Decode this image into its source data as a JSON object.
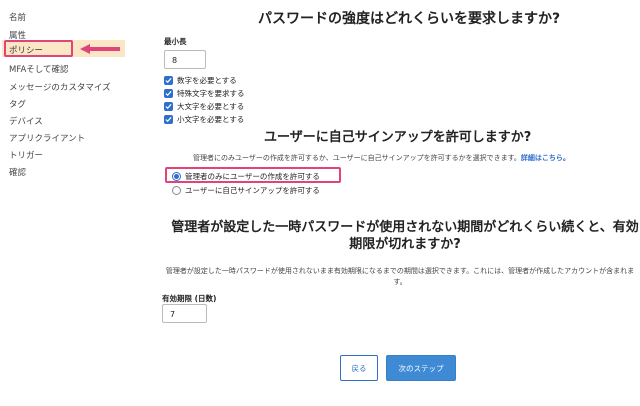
{
  "sidebar": {
    "items": [
      "名前",
      "属性",
      "ポリシー",
      "MFAそして確認",
      "メッセージのカスタマイズ",
      "タグ",
      "デバイス",
      "アプリクライアント",
      "トリガー",
      "確認"
    ],
    "active_index": 2
  },
  "password": {
    "title": "パスワードの強度はどれくらいを要求しますか?",
    "min_length_label": "最小長",
    "min_length_value": "8",
    "checkboxes": [
      {
        "label": "数字を必要とする",
        "checked": true
      },
      {
        "label": "特殊文字を要求する",
        "checked": true
      },
      {
        "label": "大文字を必要とする",
        "checked": true
      },
      {
        "label": "小文字を必要とする",
        "checked": true
      }
    ]
  },
  "signup": {
    "title": "ユーザーに自己サインアップを許可しますか?",
    "description": "管理者にのみユーザーの作成を許可するか、ユーザーに自己サインアップを許可するかを選択できます。",
    "link_text": "詳細はこちら。",
    "options": [
      {
        "label": "管理者のみにユーザーの作成を許可する",
        "selected": true
      },
      {
        "label": "ユーザーに自己サインアップを許可する",
        "selected": false
      }
    ]
  },
  "expiry": {
    "title": "管理者が設定した一時パスワードが使用されない期間がどれくらい続くと、有効期限が切れますか?",
    "description": "管理者が設定した一時パスワードが使用されないまま有効期限になるまでの期間は選択できます。これには、管理者が作成したアカウントが含まれます。",
    "days_label": "有効期限 (日数)",
    "days_value": "7"
  },
  "buttons": {
    "back": "戻る",
    "next": "次のステップ"
  },
  "colors": {
    "highlight_border": "#e0447a",
    "active_bg": "#fbe7c6",
    "primary": "#3f8ad4",
    "link": "#2e6fcc"
  }
}
